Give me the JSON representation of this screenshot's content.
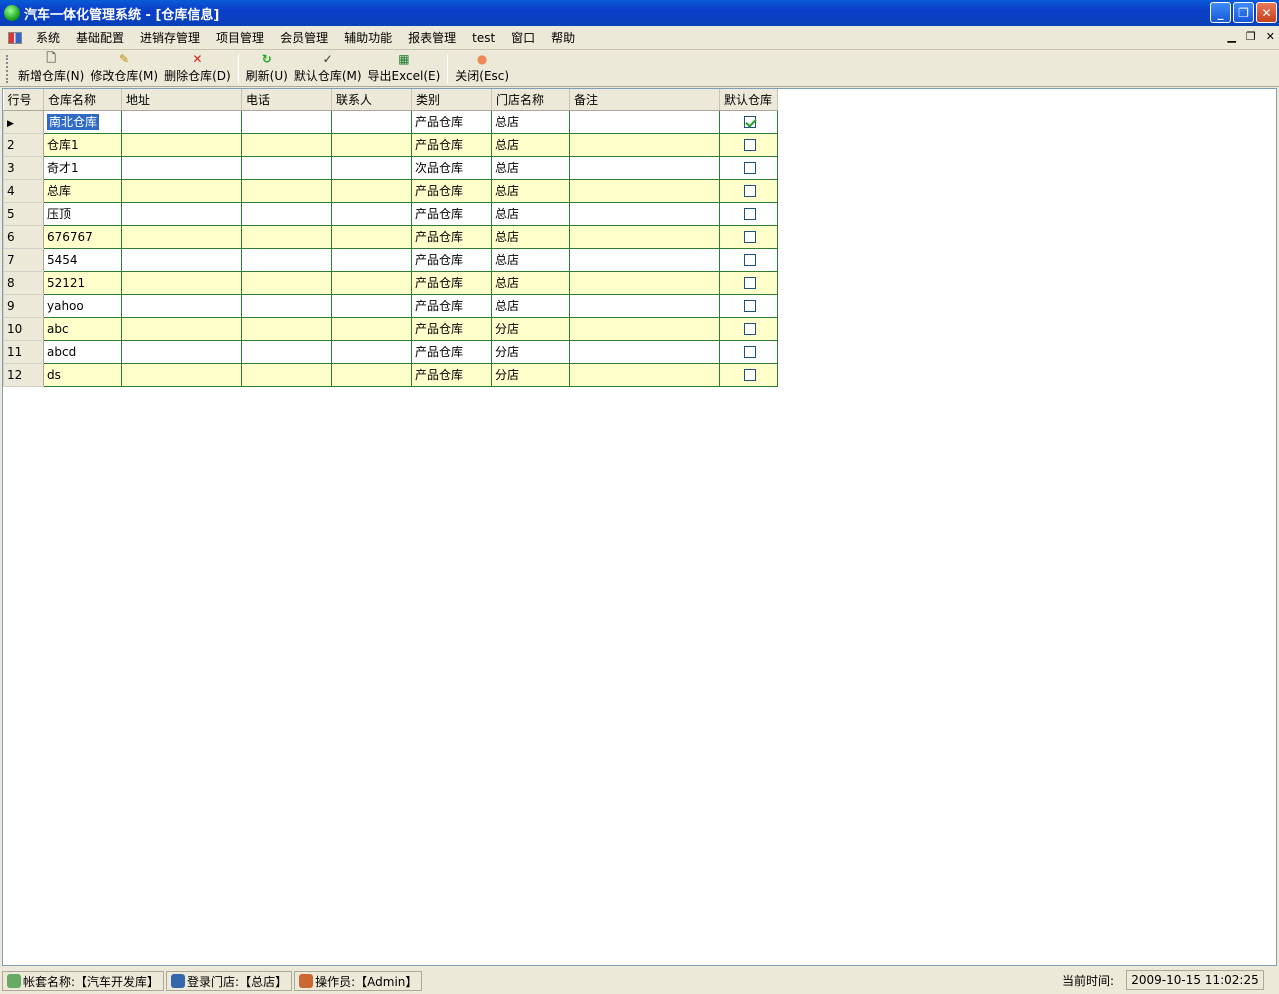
{
  "window": {
    "title": "汽车一体化管理系统 - [仓库信息]"
  },
  "menu": [
    "系统",
    "基础配置",
    "进销存管理",
    "项目管理",
    "会员管理",
    "辅助功能",
    "报表管理",
    "test",
    "窗口",
    "帮助"
  ],
  "toolbar": [
    {
      "label": "新增仓库(N)",
      "icon": "new-document-icon"
    },
    {
      "label": "修改仓库(M)",
      "icon": "edit-document-icon"
    },
    {
      "label": "删除仓库(D)",
      "icon": "delete-x-icon"
    },
    {
      "label": "刷新(U)",
      "icon": "refresh-icon"
    },
    {
      "label": "默认仓库(M)",
      "icon": "spellcheck-icon"
    },
    {
      "label": "导出Excel(E)",
      "icon": "excel-icon"
    },
    {
      "label": "关闭(Esc)",
      "icon": "close-circle-icon"
    }
  ],
  "grid": {
    "columns": [
      "行号",
      "仓库名称",
      "地址",
      "电话",
      "联系人",
      "类别",
      "门店名称",
      "备注",
      "默认仓库"
    ],
    "rows": [
      {
        "no": "",
        "name": "南北仓库",
        "addr": "",
        "phone": "",
        "contact": "",
        "type": "产品仓库",
        "store": "总店",
        "note": "",
        "default": true
      },
      {
        "no": "2",
        "name": "仓库1",
        "addr": "",
        "phone": "",
        "contact": "",
        "type": "产品仓库",
        "store": "总店",
        "note": "",
        "default": false
      },
      {
        "no": "3",
        "name": "奇才1",
        "addr": "",
        "phone": "",
        "contact": "",
        "type": "次品仓库",
        "store": "总店",
        "note": "",
        "default": false
      },
      {
        "no": "4",
        "name": "总库",
        "addr": "",
        "phone": "",
        "contact": "",
        "type": "产品仓库",
        "store": "总店",
        "note": "",
        "default": false
      },
      {
        "no": "5",
        "name": "压顶",
        "addr": "",
        "phone": "",
        "contact": "",
        "type": "产品仓库",
        "store": "总店",
        "note": "",
        "default": false
      },
      {
        "no": "6",
        "name": "676767",
        "addr": "",
        "phone": "",
        "contact": "",
        "type": "产品仓库",
        "store": "总店",
        "note": "",
        "default": false
      },
      {
        "no": "7",
        "name": "5454",
        "addr": "",
        "phone": "",
        "contact": "",
        "type": "产品仓库",
        "store": "总店",
        "note": "",
        "default": false
      },
      {
        "no": "8",
        "name": "52121",
        "addr": "",
        "phone": "",
        "contact": "",
        "type": "产品仓库",
        "store": "总店",
        "note": "",
        "default": false
      },
      {
        "no": "9",
        "name": "yahoo",
        "addr": "",
        "phone": "",
        "contact": "",
        "type": "产品仓库",
        "store": "总店",
        "note": "",
        "default": false
      },
      {
        "no": "10",
        "name": "abc",
        "addr": "",
        "phone": "",
        "contact": "",
        "type": "产品仓库",
        "store": "分店",
        "note": "",
        "default": false
      },
      {
        "no": "11",
        "name": "abcd",
        "addr": "",
        "phone": "",
        "contact": "",
        "type": "产品仓库",
        "store": "分店",
        "note": "",
        "default": false
      },
      {
        "no": "12",
        "name": "ds",
        "addr": "",
        "phone": "",
        "contact": "",
        "type": "产品仓库",
        "store": "分店",
        "note": "",
        "default": false
      }
    ]
  },
  "status": {
    "account": "帐套名称:【汽车开发库】",
    "store": "登录门店:【总店】",
    "operator": "操作员:【Admin】",
    "time_label": "当前时间:",
    "time_value": "2009-10-15 11:02:25"
  }
}
